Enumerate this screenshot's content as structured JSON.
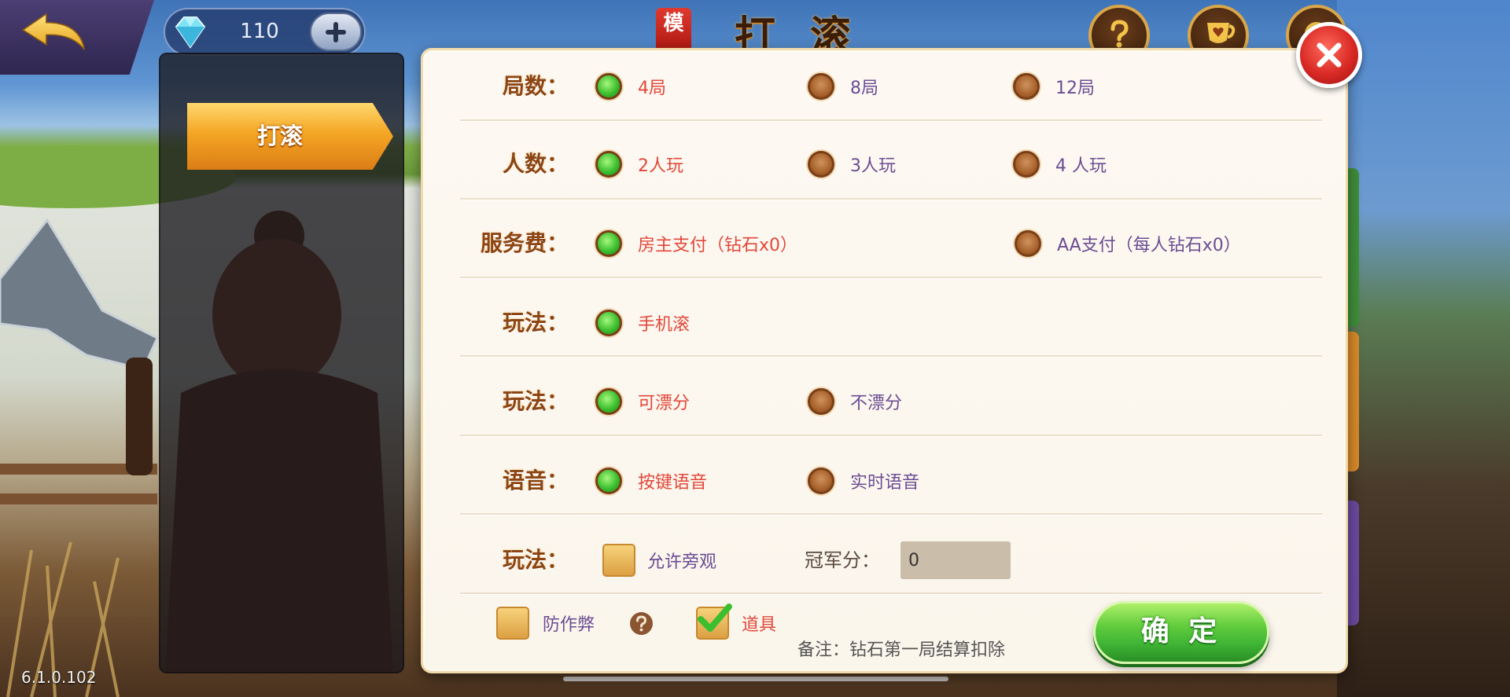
{
  "header": {
    "badge": "模",
    "title": "打滚",
    "diamond_count": "110"
  },
  "sidebar": {
    "tabs": [
      {
        "label": "打滚",
        "active": true
      }
    ]
  },
  "form": {
    "rows": [
      {
        "label": "局数：",
        "options": [
          {
            "label": "4局",
            "selected": true
          },
          {
            "label": "8局",
            "selected": false
          },
          {
            "label": "12局",
            "selected": false
          }
        ]
      },
      {
        "label": "人数：",
        "options": [
          {
            "label": "2人玩",
            "selected": true
          },
          {
            "label": "3人玩",
            "selected": false
          },
          {
            "label": "4 人玩",
            "selected": false
          }
        ]
      },
      {
        "label": "服务费：",
        "options": [
          {
            "label": "房主支付（钻石x0）",
            "selected": true
          },
          {
            "label": "AA支付（每人钻石x0）",
            "selected": false
          }
        ]
      },
      {
        "label": "玩法：",
        "options": [
          {
            "label": "手机滚",
            "selected": true
          }
        ]
      },
      {
        "label": "玩法：",
        "options": [
          {
            "label": "可漂分",
            "selected": true
          },
          {
            "label": "不漂分",
            "selected": false
          }
        ]
      },
      {
        "label": "语音：",
        "options": [
          {
            "label": "按键语音",
            "selected": true
          },
          {
            "label": "实时语音",
            "selected": false
          }
        ]
      },
      {
        "label": "玩法：",
        "allow_spectate": {
          "label": "允许旁观",
          "checked": false
        },
        "champion_score": {
          "label": "冠军分：",
          "value": "0"
        }
      }
    ],
    "anti_cheat": {
      "label": "防作弊",
      "checked": false
    },
    "props": {
      "label": "道具",
      "checked": true
    },
    "note": "备注：钻石第一局结算扣除",
    "confirm_label": "确 定"
  },
  "version": "6.1.0.102",
  "icons": {
    "back": "back-arrow-icon",
    "diamond": "diamond-icon",
    "add": "plus-icon",
    "help": "help-icon",
    "cup": "cup-icon",
    "settings": "settings-icon",
    "close": "close-icon",
    "question": "question-icon",
    "check": "check-icon"
  },
  "colors": {
    "panel_bg": "#fbf6ec",
    "label_text": "#8c4513",
    "selected_text": "#e2473a",
    "unselected_text": "#6b4c93",
    "radio_selected": "#3cbf2f",
    "radio_unselected": "#a8622c",
    "confirm_button": "#3fb435",
    "close_button": "#d92a25",
    "tab_active": "#f0a020"
  }
}
